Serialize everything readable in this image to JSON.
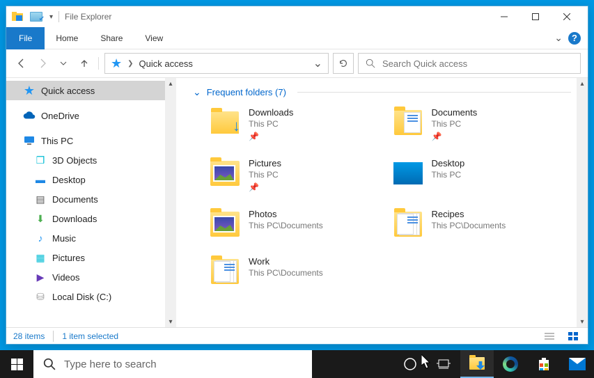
{
  "window": {
    "title": "File Explorer"
  },
  "ribbon": {
    "tabs": {
      "file": "File",
      "home": "Home",
      "share": "Share",
      "view": "View"
    }
  },
  "address": {
    "current": "Quick access"
  },
  "search": {
    "placeholder": "Search Quick access"
  },
  "nav": {
    "quick_access": "Quick access",
    "onedrive": "OneDrive",
    "this_pc": "This PC",
    "objects3d": "3D Objects",
    "desktop": "Desktop",
    "documents": "Documents",
    "downloads": "Downloads",
    "music": "Music",
    "pictures": "Pictures",
    "videos": "Videos",
    "local_disk": "Local Disk (C:)"
  },
  "group": {
    "header": "Frequent folders (7)"
  },
  "folders": [
    {
      "name": "Downloads",
      "location": "This PC",
      "pinned": true
    },
    {
      "name": "Documents",
      "location": "This PC",
      "pinned": true
    },
    {
      "name": "Pictures",
      "location": "This PC",
      "pinned": true
    },
    {
      "name": "Desktop",
      "location": "This PC",
      "pinned": false
    },
    {
      "name": "Photos",
      "location": "This PC\\Documents",
      "pinned": false
    },
    {
      "name": "Recipes",
      "location": "This PC\\Documents",
      "pinned": false
    },
    {
      "name": "Work",
      "location": "This PC\\Documents",
      "pinned": false
    }
  ],
  "status": {
    "items": "28 items",
    "selected": "1 item selected"
  },
  "taskbar": {
    "search_placeholder": "Type here to search"
  }
}
